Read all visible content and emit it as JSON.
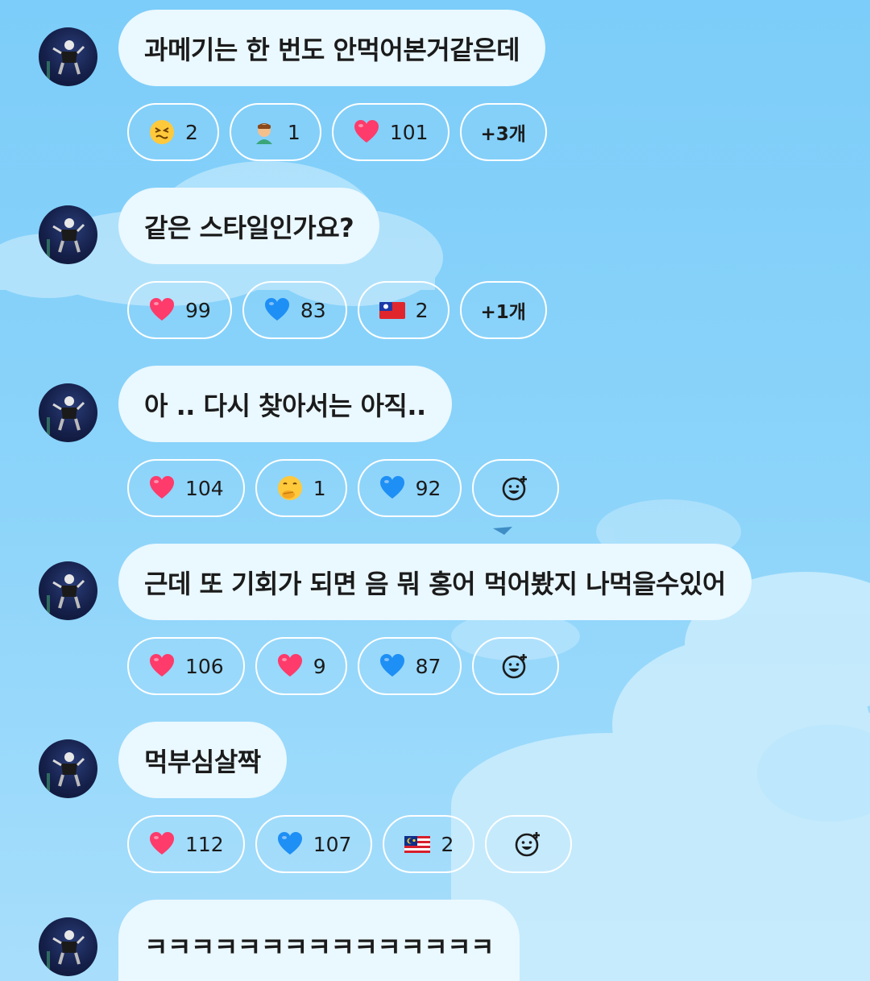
{
  "messages": [
    {
      "text": "과메기는 한 번도 안먹어본거같은데",
      "reactions": [
        {
          "icon": "grimacing-face",
          "count": "2"
        },
        {
          "icon": "man-emoji",
          "count": "1"
        },
        {
          "icon": "red-heart",
          "count": "101"
        },
        {
          "more": "+3개"
        }
      ]
    },
    {
      "text": "같은 스타일인가요?",
      "reactions": [
        {
          "icon": "red-heart",
          "count": "99"
        },
        {
          "icon": "blue-heart",
          "count": "83"
        },
        {
          "icon": "taiwan-flag",
          "count": "2"
        },
        {
          "more": "+1개"
        }
      ]
    },
    {
      "text": "아 .. 다시 찾아서는 아직..",
      "reactions": [
        {
          "icon": "red-heart",
          "count": "104"
        },
        {
          "icon": "face-with-hand-over-mouth",
          "count": "1"
        },
        {
          "icon": "blue-heart",
          "count": "92"
        },
        {
          "add": true
        }
      ]
    },
    {
      "text": "근데 또 기회가 되면 음 뭐 홍어 먹어봤지 나먹을수있어",
      "reactions": [
        {
          "icon": "red-heart",
          "count": "106"
        },
        {
          "icon": "red-heart",
          "count": "9"
        },
        {
          "icon": "blue-heart",
          "count": "87"
        },
        {
          "add": true
        }
      ]
    },
    {
      "text": "먹부심살짝",
      "reactions": [
        {
          "icon": "red-heart",
          "count": "112"
        },
        {
          "icon": "blue-heart",
          "count": "107"
        },
        {
          "icon": "malaysia-flag",
          "count": "2"
        },
        {
          "add": true
        }
      ]
    },
    {
      "text": "ㅋㅋㅋㅋㅋㅋㅋㅋㅋㅋㅋㅋㅋㅋㅋ",
      "reactions": []
    }
  ],
  "colors": {
    "sky_top": "#7ccdf9",
    "bubble": "#eaf8ff",
    "chip_border": "#ffffff",
    "heart_red": "#ff3b6b",
    "heart_blue": "#1e8ff5"
  }
}
